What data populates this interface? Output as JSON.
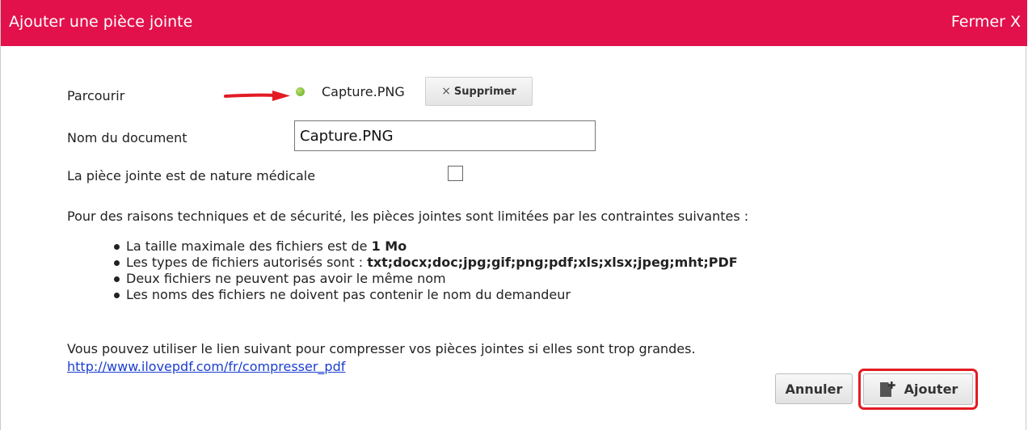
{
  "dialog": {
    "title": "Ajouter une pièce jointe",
    "close_label": "Fermer X",
    "accent_color": "#e2114b"
  },
  "form": {
    "browse_label": "Parcourir",
    "file_name": "Capture.PNG",
    "file_status_color": "#7cb93a",
    "remove_button_x": "×",
    "remove_button_label": "Supprimer",
    "doc_name_label": "Nom du document",
    "doc_name_value": "Capture.PNG",
    "medical_label": "La pièce jointe est de nature médicale",
    "medical_checked": false
  },
  "info": {
    "intro": "Pour des raisons techniques et de sécurité, les pièces jointes sont limitées par les contraintes suivantes :",
    "rules": {
      "size_prefix": "La taille maximale des fichiers est de ",
      "size_value": "1 Mo",
      "types_prefix": "Les types de fichiers autorisés sont : ",
      "types_value": "txt;docx;doc;jpg;gif;png;pdf;xls;xlsx;jpeg;mht;PDF",
      "same_name": "Deux fichiers ne peuvent pas avoir le même nom",
      "no_requester": "Les noms des fichiers ne doivent pas contenir le nom du demandeur"
    },
    "compress_text": "Vous pouvez utiliser le lien suivant pour compresser vos pièces jointes si elles sont trop grandes.",
    "compress_link": "http://www.ilovepdf.com/fr/compresser_pdf"
  },
  "actions": {
    "cancel_label": "Annuler",
    "add_label": "Ajouter",
    "highlight_color": "#e31b23"
  },
  "icons": {
    "arrow": "red-arrow-icon",
    "status": "green-dot-icon",
    "add": "file-add-icon"
  }
}
